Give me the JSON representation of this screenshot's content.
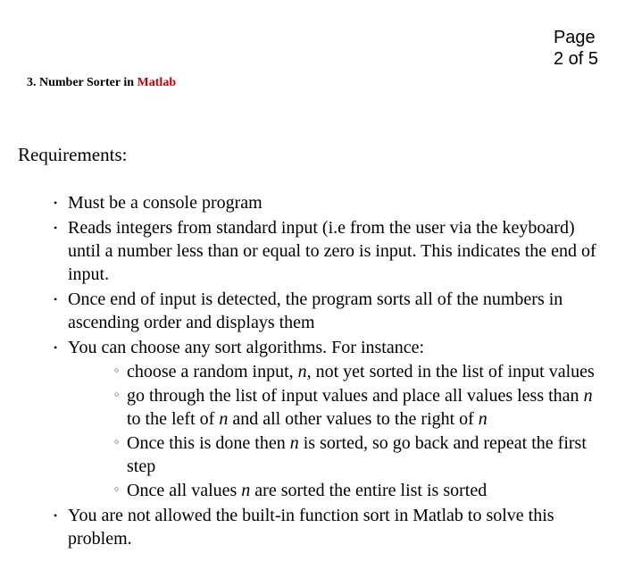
{
  "page": {
    "label_line1": "Page",
    "label_line2": "2 of 5"
  },
  "heading": {
    "prefix": "3. Number Sorter in ",
    "highlight": "Matlab"
  },
  "requirements_label": "Requirements:",
  "bullets": {
    "b1": "Must be a console program",
    "b2": "Reads integers from standard input (i.e from the user via the keyboard) until a number less than or equal to zero is input. This indicates the end of input.",
    "b3": "Once end of input is detected, the program sorts all of the numbers in ascending order and displays them",
    "b4": "You can choose any sort algorithms. For instance:",
    "b5": "You are not allowed the built-in function sort in Matlab to solve this problem."
  },
  "sub": {
    "s1_a": "choose a random input, ",
    "s1_n": "n",
    "s1_b": ", not yet sorted in the list of input values",
    "s2_a": "go through the list of input values and place all values less than ",
    "s2_n1": "n",
    "s2_b": " to the left of ",
    "s2_n2": "n",
    "s2_c": " and all other values to the right of ",
    "s2_n3": "n",
    "s3_a": "Once this is done then ",
    "s3_n": "n",
    "s3_b": " is sorted, so go back and repeat the first step",
    "s4_a": "Once all values ",
    "s4_n": "n",
    "s4_b": " are sorted the entire list is sorted"
  }
}
